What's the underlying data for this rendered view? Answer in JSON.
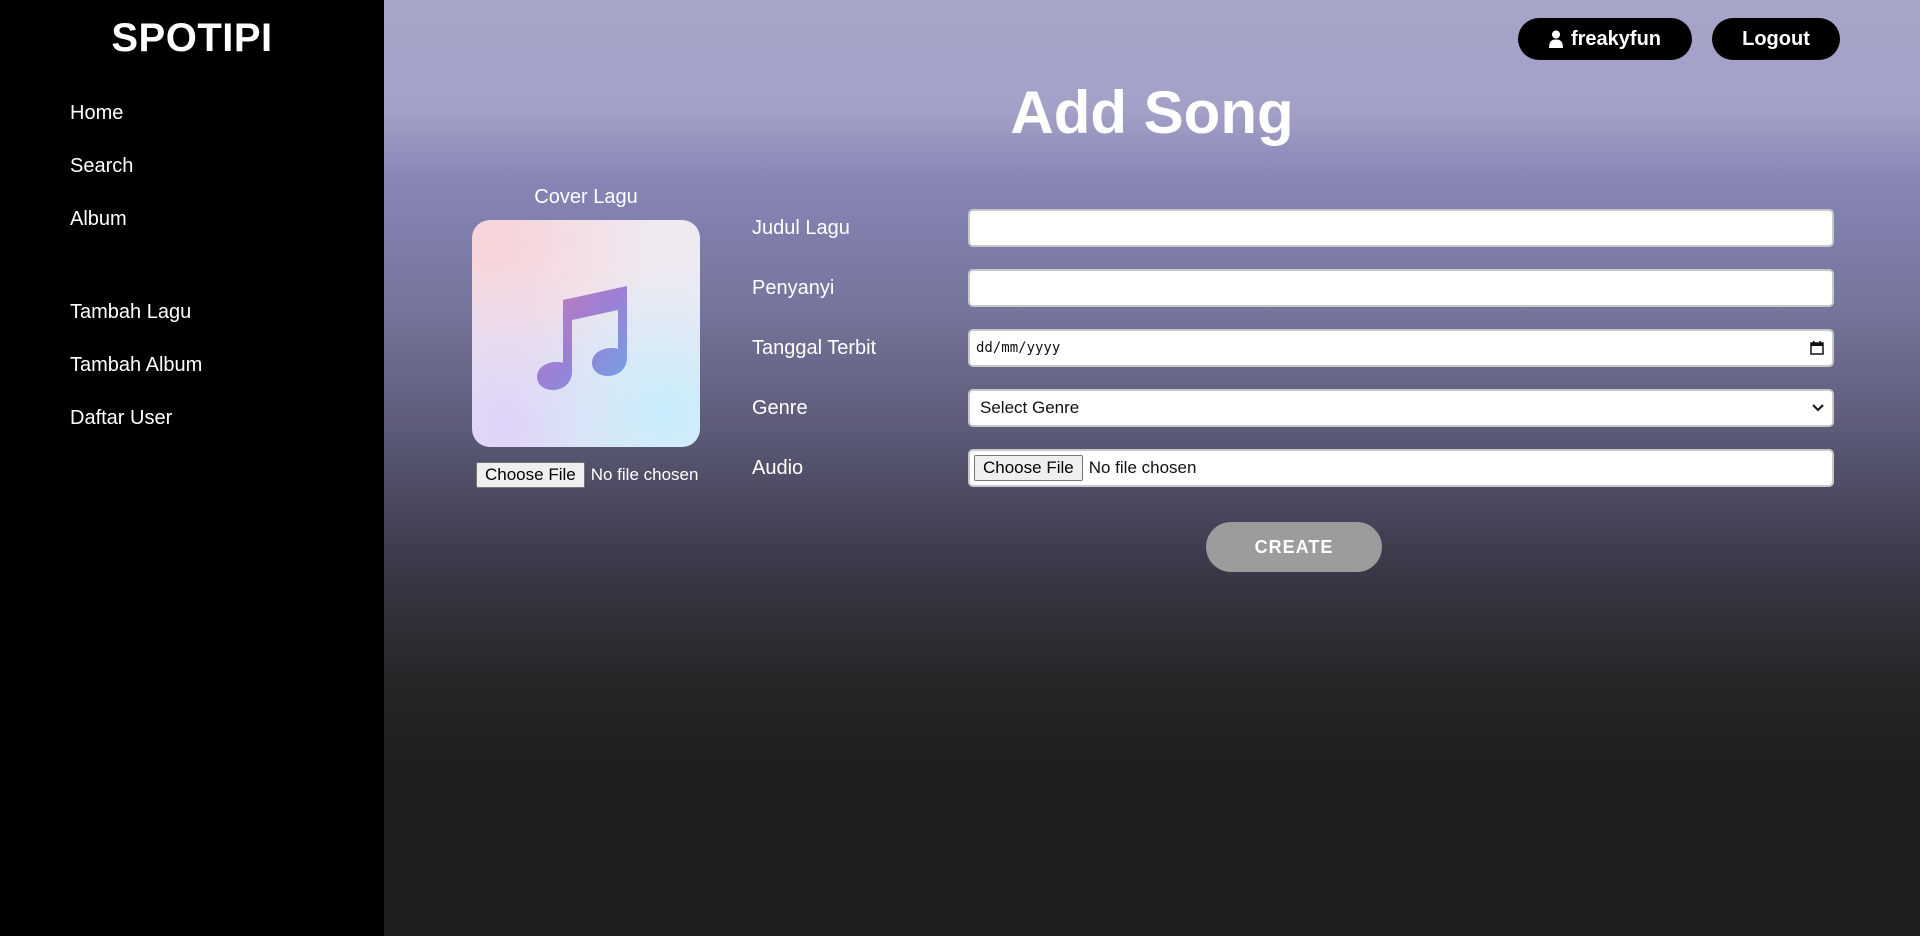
{
  "sidebar": {
    "brand": "SPOTIPI",
    "items": [
      {
        "label": "Home"
      },
      {
        "label": "Search"
      },
      {
        "label": "Album"
      },
      {
        "label": "Tambah Lagu"
      },
      {
        "label": "Tambah Album"
      },
      {
        "label": "Daftar User"
      }
    ]
  },
  "header": {
    "username": "freakyfun",
    "user_icon": "user-icon",
    "logout_label": "Logout"
  },
  "page": {
    "title": "Add Song"
  },
  "cover": {
    "label": "Cover Lagu",
    "icon": "music-note-icon",
    "choose_file_label": "Choose File",
    "file_status": "No file chosen"
  },
  "form": {
    "title_label": "Judul Lagu",
    "title_value": "",
    "singer_label": "Penyanyi",
    "singer_value": "",
    "date_label": "Tanggal Terbit",
    "date_placeholder": "dd/mm/yyyy",
    "genre_label": "Genre",
    "genre_selected": "Select Genre",
    "audio_label": "Audio",
    "audio_choose_label": "Choose File",
    "audio_status": "No file chosen"
  },
  "actions": {
    "create_label": "CREATE"
  },
  "colors": {
    "sidebar_bg": "#000000",
    "gradient_top": "#a5a4c9",
    "gradient_bottom": "#1f1f1f",
    "button_disabled": "#9c9c9c"
  }
}
